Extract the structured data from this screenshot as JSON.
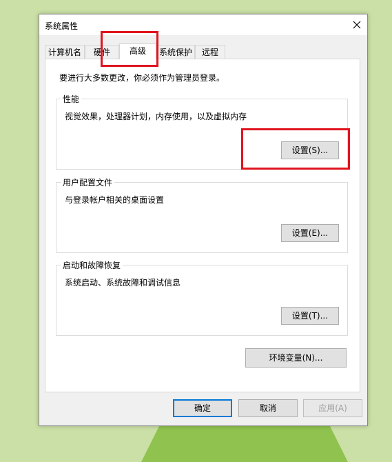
{
  "window": {
    "title": "系统属性"
  },
  "tabs": [
    {
      "label": "计算机名"
    },
    {
      "label": "硬件"
    },
    {
      "label": "高级"
    },
    {
      "label": "系统保护"
    },
    {
      "label": "远程"
    }
  ],
  "advanced": {
    "notice": "要进行大多数更改，你必须作为管理员登录。",
    "performance": {
      "title": "性能",
      "desc": "视觉效果，处理器计划，内存使用，以及虚拟内存",
      "button": "设置(S)..."
    },
    "user_profiles": {
      "title": "用户配置文件",
      "desc": "与登录帐户相关的桌面设置",
      "button": "设置(E)..."
    },
    "startup_recovery": {
      "title": "启动和故障恢复",
      "desc": "系统启动、系统故障和调试信息",
      "button": "设置(T)..."
    },
    "env_button": "环境变量(N)..."
  },
  "footer": {
    "ok": "确定",
    "cancel": "取消",
    "apply": "应用(A)"
  },
  "colors": {
    "highlight": "#e0141e",
    "accent": "#0078d7"
  }
}
